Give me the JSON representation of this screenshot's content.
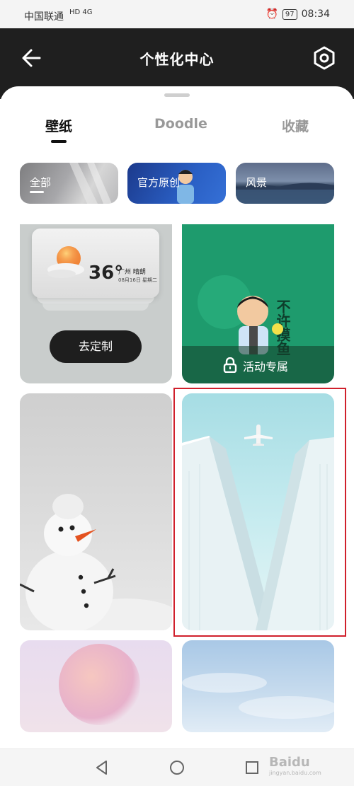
{
  "status_bar": {
    "carrier": "中国联通",
    "network": "HD 4G",
    "battery": "97",
    "time": "08:34"
  },
  "header": {
    "title": "个性化中心",
    "back_icon": "back-arrow-icon",
    "settings_icon": "settings-icon"
  },
  "tabs": [
    {
      "label": "壁纸",
      "active": true
    },
    {
      "label": "Doodle",
      "active": false
    },
    {
      "label": "收藏",
      "active": false
    }
  ],
  "categories": [
    {
      "label": "全部",
      "selected": true
    },
    {
      "label": "官方原创",
      "selected": false
    },
    {
      "label": "风景",
      "selected": false
    }
  ],
  "widget_card": {
    "temperature": "36°",
    "city_weather": "广州  晴朗",
    "date": "08月16日 星期二",
    "button_label": "去定制"
  },
  "event_card": {
    "label": "活动专属",
    "deco_text": "不许摸鱼"
  },
  "bottom_nav": {
    "watermark": "Baidu",
    "watermark_sub": "jingyan.baidu.com"
  },
  "colors": {
    "header_bg": "#1f1f1f",
    "highlight_outline": "#d0202c",
    "event_green": "#1e9b6d"
  }
}
